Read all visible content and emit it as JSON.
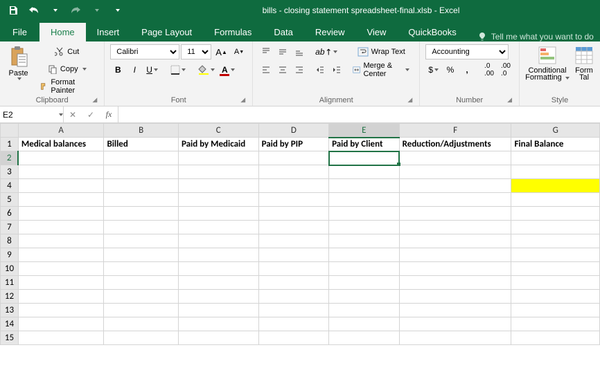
{
  "app": {
    "title": "bills - closing statement spreadsheet-final.xlsb - Excel"
  },
  "tabs": {
    "file": "File",
    "home": "Home",
    "insert": "Insert",
    "page_layout": "Page Layout",
    "formulas": "Formulas",
    "data": "Data",
    "review": "Review",
    "view": "View",
    "quickbooks": "QuickBooks",
    "tellme": "Tell me what you want to do"
  },
  "ribbon": {
    "clipboard": {
      "label": "Clipboard",
      "paste": "Paste",
      "cut": "Cut",
      "copy": "Copy",
      "format_painter": "Format Painter"
    },
    "font": {
      "label": "Font",
      "name": "Calibri",
      "size": "11"
    },
    "alignment": {
      "label": "Alignment",
      "wrap": "Wrap Text",
      "merge": "Merge & Center"
    },
    "number": {
      "label": "Number",
      "format": "Accounting"
    },
    "styles": {
      "label": "Style",
      "conditional": "Conditional",
      "conditional2": "Formatting",
      "format": "Form",
      "format2": "Tal"
    }
  },
  "formula_bar": {
    "cell_ref": "E2",
    "formula": ""
  },
  "columns": [
    {
      "letter": "A",
      "width": 124,
      "header": "Medical balances"
    },
    {
      "letter": "B",
      "width": 108,
      "header": "Billed"
    },
    {
      "letter": "C",
      "width": 116,
      "header": "Paid by Medicaid"
    },
    {
      "letter": "D",
      "width": 102,
      "header": "Paid by PIP"
    },
    {
      "letter": "E",
      "width": 102,
      "header": "Paid by Client"
    },
    {
      "letter": "F",
      "width": 162,
      "header": "Reduction/Adjustments"
    },
    {
      "letter": "G",
      "width": 128,
      "header": "Final Balance"
    }
  ],
  "row_count": 15,
  "selected": {
    "col": "E",
    "row": 2
  },
  "highlight": {
    "col": "G",
    "row": 4,
    "color": "#ffff00"
  }
}
